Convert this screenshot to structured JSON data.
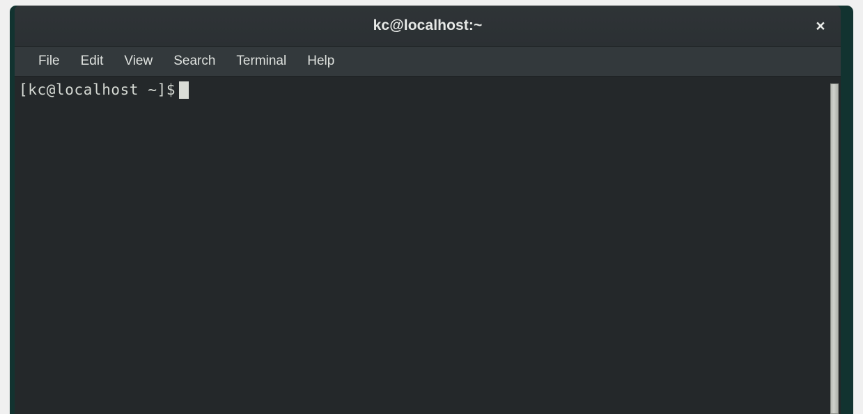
{
  "window": {
    "title": "kc@localhost:~",
    "close_icon": "close-icon",
    "close_glyph": "×",
    "frame_color": "#123330",
    "titlebar_color": "#2f3437"
  },
  "menu": {
    "items": [
      {
        "label": "File"
      },
      {
        "label": "Edit"
      },
      {
        "label": "View"
      },
      {
        "label": "Search"
      },
      {
        "label": "Terminal"
      },
      {
        "label": "Help"
      }
    ]
  },
  "terminal": {
    "background_color": "#24282a",
    "foreground_color": "#d6dad4",
    "lines": [
      {
        "prompt": "[kc@localhost ~]$",
        "command": ""
      }
    ],
    "cursor": {
      "type": "block",
      "color": "#d9dcd6",
      "visible": true
    }
  },
  "scrollbar": {
    "orientation": "vertical",
    "thumb_color": "#cfd2cc",
    "track_color": "#24282a"
  }
}
